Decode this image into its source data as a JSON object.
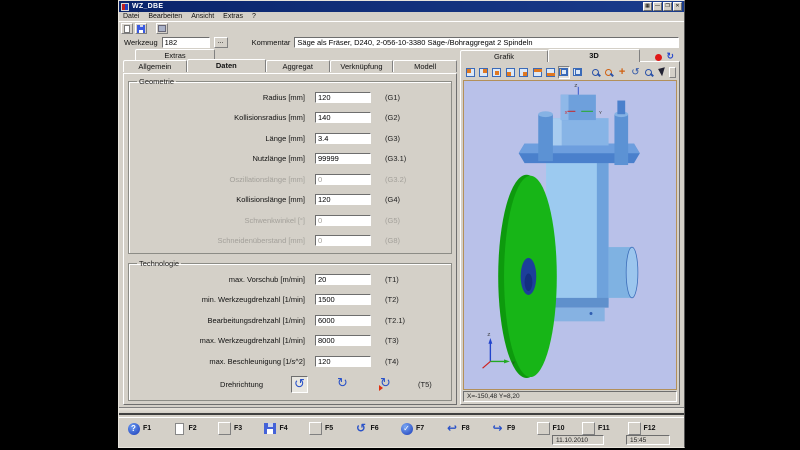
{
  "window": {
    "title": "WZ_DBE",
    "buttons": [
      "▦",
      "—",
      "❒",
      "✕"
    ]
  },
  "menu": {
    "items": [
      "Datei",
      "Bearbeiten",
      "Ansicht",
      "Extras",
      "?"
    ]
  },
  "toolbar": {
    "icons": [
      "new-file-icon",
      "save-icon",
      "properties-icon"
    ]
  },
  "header": {
    "werkzeug_label": "Werkzeug",
    "werkzeug_value": "182",
    "browse_label": "...",
    "kommentar_label": "Kommentar",
    "kommentar_value": "Säge als Fräser, D240, 2-056-10-3380 Säge-/Bohraggregat 2 Spindeln"
  },
  "tabs": {
    "extras": "Extras",
    "main": [
      "Allgemein",
      "Daten",
      "Aggregat",
      "Verknüpfung",
      "Modell"
    ],
    "active": "Daten"
  },
  "geometrie": {
    "title": "Geometrie",
    "rows": [
      {
        "label": "Radius [mm]",
        "value": "120",
        "code": "(G1)",
        "disabled": false
      },
      {
        "label": "Kollisionsradius [mm]",
        "value": "140",
        "code": "(G2)",
        "disabled": false
      },
      {
        "label": "Länge [mm]",
        "value": "3.4",
        "code": "(G3)",
        "disabled": false
      },
      {
        "label": "Nutzlänge [mm]",
        "value": "99999",
        "code": "(G3.1)",
        "disabled": false
      },
      {
        "label": "Oszillationslänge [mm]",
        "value": "0",
        "code": "(G3.2)",
        "disabled": true
      },
      {
        "label": "Kollisionslänge [mm]",
        "value": "120",
        "code": "(G4)",
        "disabled": false
      },
      {
        "label": "Schwenkwinkel [°]",
        "value": "0",
        "code": "(G5)",
        "disabled": true
      },
      {
        "label": "Schneidenüberstand [mm]",
        "value": "0",
        "code": "(G8)",
        "disabled": true
      }
    ]
  },
  "technologie": {
    "title": "Technologie",
    "rows": [
      {
        "label": "max. Vorschub [m/min]",
        "value": "20",
        "code": "(T1)",
        "disabled": false
      },
      {
        "label": "min. Werkzeugdrehzahl [1/min]",
        "value": "1500",
        "code": "(T2)",
        "disabled": false
      },
      {
        "label": "Bearbeitungsdrehzahl [1/min]",
        "value": "6000",
        "code": "(T2.1)",
        "disabled": false
      },
      {
        "label": "max. Werkzeugdrehzahl [1/min]",
        "value": "8000",
        "code": "(T3)",
        "disabled": false
      },
      {
        "label": "max. Beschleunigung [1/s^2]",
        "value": "120",
        "code": "(T4)",
        "disabled": false
      }
    ],
    "drehrichtung": {
      "label": "Drehrichtung",
      "code": "(T5)",
      "icons": [
        "rotate-ccw-icon",
        "rotate-cw-icon",
        "rotate-cw-alt-icon"
      ],
      "glyph_ccw": "↺",
      "glyph_cw": "↻"
    }
  },
  "graphics": {
    "tabs": [
      "Grafik",
      "3D"
    ],
    "active": "3D",
    "extra_icons": [
      "record-dot-icon",
      "refresh-icon"
    ],
    "refresh_glyph": "↻",
    "toolbar_icons": [
      "view-iso-icon",
      "view-front-icon",
      "view-back-icon",
      "view-left-icon",
      "view-right-icon",
      "view-top-icon",
      "view-bottom-icon",
      "view-window-icon",
      "view-free-icon",
      "zoom-in-icon",
      "zoom-window-icon",
      "pan-icon",
      "rotate-view-icon",
      "zoom-dynamic-icon",
      "select-icon"
    ],
    "status": "X=-150,48 Y=8,20",
    "axes": {
      "x": "X",
      "y": "Y",
      "z": "Z"
    },
    "colors": {
      "viewport_bg": "#b9c1e9",
      "blade_green": "#17b517",
      "machine_blue": "#9ccaf0",
      "hub_navy": "#1c3f9a"
    }
  },
  "fkeys": {
    "buttons": [
      {
        "label": "F1",
        "icon": "help-icon"
      },
      {
        "label": "F2",
        "icon": "new-document-icon"
      },
      {
        "label": "F3",
        "icon": "blank"
      },
      {
        "label": "F4",
        "icon": "save-icon"
      },
      {
        "label": "F5",
        "icon": "blank"
      },
      {
        "label": "F6",
        "icon": "undo-rotate-icon"
      },
      {
        "label": "F7",
        "icon": "confirm-icon"
      },
      {
        "label": "F8",
        "icon": "arrow-back-icon"
      },
      {
        "label": "F9",
        "icon": "arrow-forward-icon"
      },
      {
        "label": "F10",
        "icon": "blank"
      },
      {
        "label": "F11",
        "icon": "blank"
      },
      {
        "label": "F12",
        "icon": "blank"
      }
    ],
    "glyphs": {
      "help": "?",
      "undo": "↺",
      "check": "✓",
      "back": "↩",
      "forward": "↪"
    },
    "date": "11.10.2010",
    "time": "15:45"
  }
}
